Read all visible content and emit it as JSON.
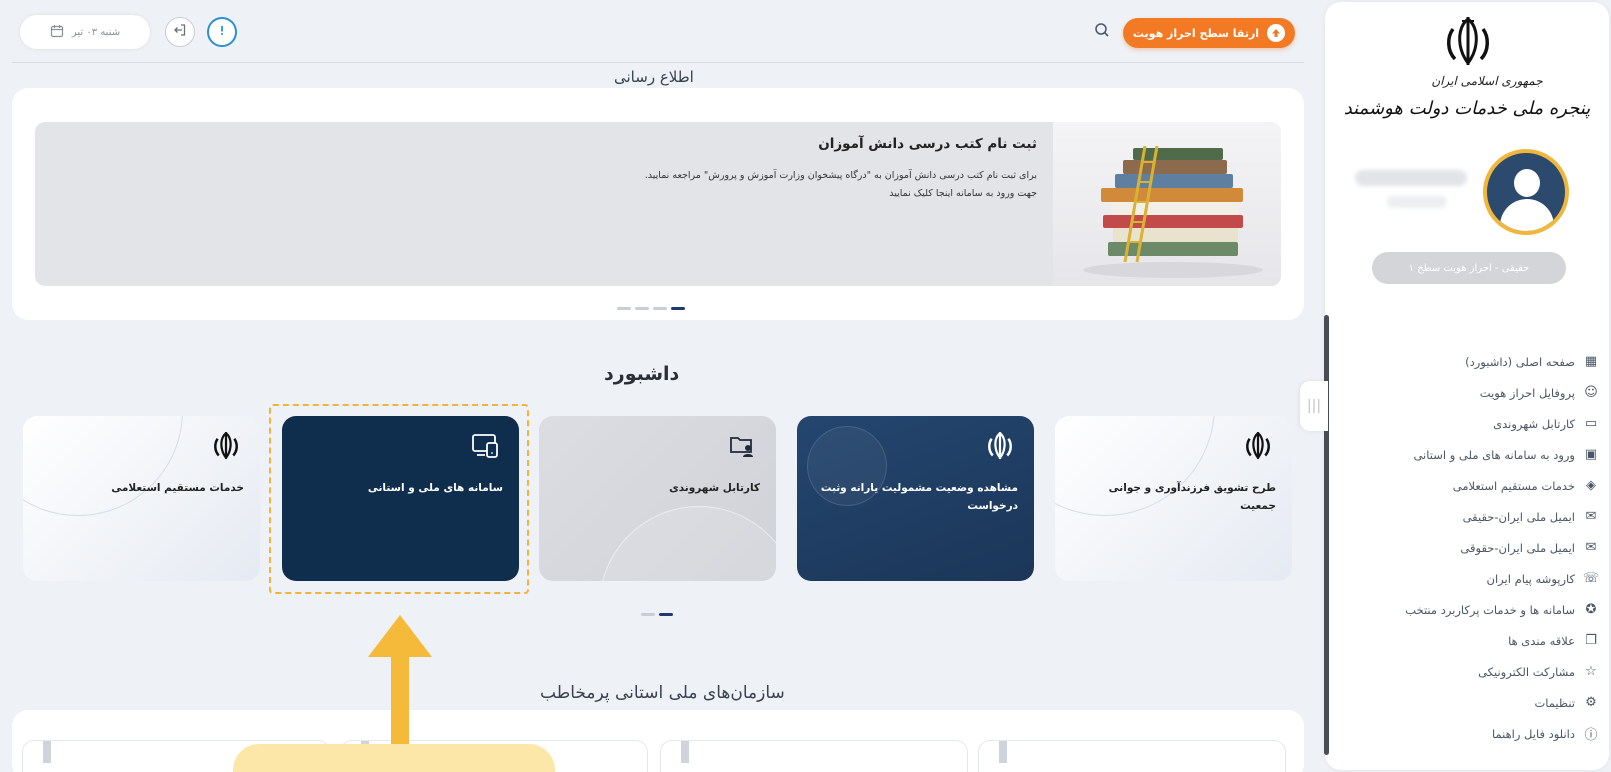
{
  "topbar": {
    "date_label": "شنبه ۰۳ تیر",
    "upgrade_label": "ارتقا سطح احراز هویت"
  },
  "sidebar": {
    "brand_line1": "جمهوری اسلامی ایران",
    "brand_line2": "پنجره ملی خدمات دولت هوشمند",
    "level_badge": "حقیقی - احراز هویت سطح ۱",
    "collapse_glyph": "|||",
    "items": [
      {
        "label": "صفحه اصلی (داشبورد)",
        "icon": "grid-icon",
        "glyph": "▦",
        "active": true
      },
      {
        "label": "پروفایل احراز هویت",
        "icon": "profile-icon",
        "glyph": "☺",
        "active": false
      },
      {
        "label": "کارتابل شهروندی",
        "icon": "folder-user-icon",
        "glyph": "▭",
        "active": false
      },
      {
        "label": "ورود به سامانه های ملی و استانی",
        "icon": "devices-icon",
        "glyph": "▣",
        "active": false
      },
      {
        "label": "خدمات مستقیم استعلامی",
        "icon": "layers-icon",
        "glyph": "◈",
        "active": false
      },
      {
        "label": "ایمیل ملی ایران-حقیقی",
        "icon": "mail-icon",
        "glyph": "✉",
        "active": false
      },
      {
        "label": "ایمیل ملی ایران-حقوقی",
        "icon": "mail-icon",
        "glyph": "✉",
        "active": false
      },
      {
        "label": "کارپوشه پیام ایران",
        "icon": "message-icon",
        "glyph": "☏",
        "active": false
      },
      {
        "label": "سامانه ها و خدمات پرکاربرد منتخب",
        "icon": "award-icon",
        "glyph": "✪",
        "active": false
      },
      {
        "label": "علاقه مندی ها",
        "icon": "bookmark-icon",
        "glyph": "❐",
        "active": false
      },
      {
        "label": "مشارکت الکترونیکی",
        "icon": "star-icon",
        "glyph": "☆",
        "active": false
      },
      {
        "label": "تنظیمات",
        "icon": "gear-icon",
        "glyph": "⚙",
        "active": false
      },
      {
        "label": "دانلود فایل راهنما",
        "icon": "info-icon",
        "glyph": "ⓘ",
        "active": false
      }
    ]
  },
  "news": {
    "section_title": "اطلاع رسانی",
    "title": "ثبت نام کتب درسی دانش آموزان",
    "line1": "برای ثبت نام کتب درسی دانش آموزان به \"درگاه پیشخوان وزارت آموزش و پرورش\" مراجعه نمایید.",
    "line2": "جهت ورود به سامانه اینجا کلیک نمایید"
  },
  "dashboard": {
    "title": "داشبورد",
    "cards": [
      {
        "label": "طرح تشویق فرزندآوری و جوانی جمعیت",
        "icon": "emblem-icon"
      },
      {
        "label": "مشاهده وضعیت مشمولیت یارانه وثبت درخواست",
        "icon": "emblem-icon"
      },
      {
        "label": "کارتابل شهروندی",
        "icon": "folder-user-icon"
      },
      {
        "label": "سامانه های ملی و استانی",
        "icon": "devices-icon"
      },
      {
        "label": "خدمات مستقیم استعلامی",
        "icon": "emblem-icon"
      }
    ]
  },
  "provinces": {
    "title": "سازمان‌های ملی استانی پرمخاطب"
  },
  "colors": {
    "accent_orange": "#f27a25",
    "navy": "#1b3658",
    "dark_card": "#0f2e4d",
    "annotation_yellow": "#f6ba3a",
    "active_nav": "#2a3f8f"
  }
}
